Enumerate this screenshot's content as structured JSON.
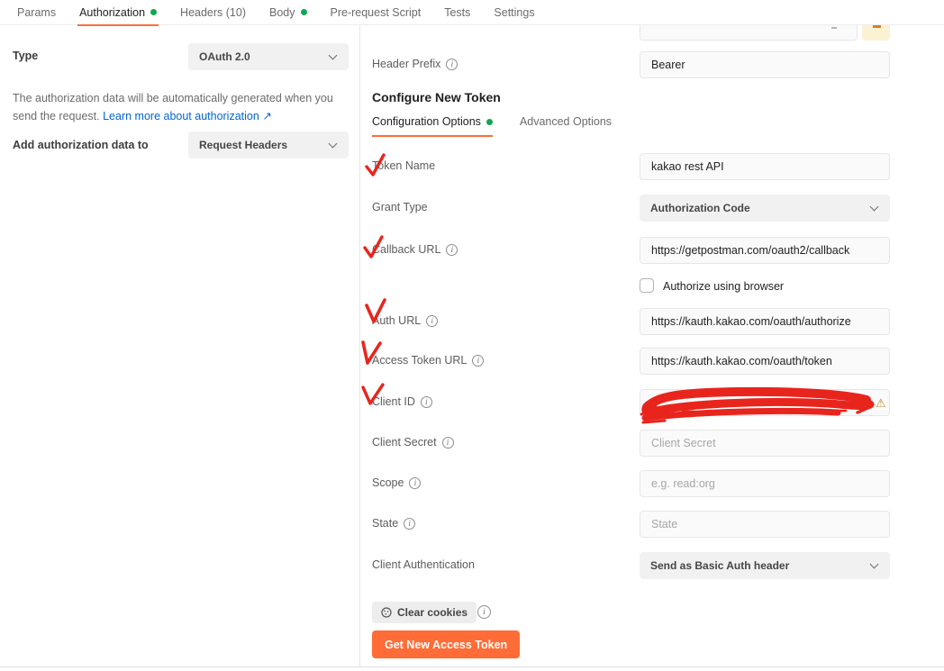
{
  "tab_bar": {
    "tabs": [
      {
        "label": "Params",
        "active": false,
        "has_dot": false
      },
      {
        "label": "Authorization",
        "active": true,
        "has_dot": true
      },
      {
        "label": "Headers (10)",
        "active": false,
        "has_dot": false
      },
      {
        "label": "Body",
        "active": false,
        "has_dot": true
      },
      {
        "label": "Pre-request Script",
        "active": false,
        "has_dot": false
      },
      {
        "label": "Tests",
        "active": false,
        "has_dot": false
      },
      {
        "label": "Settings",
        "active": false,
        "has_dot": false
      }
    ]
  },
  "left_panel": {
    "type_label": "Type",
    "type_value": "OAuth 2.0",
    "description": "The authorization data will be automatically generated when you send the request.",
    "learn_more_link": "Learn more about authorization",
    "external_link_arrow": "↗",
    "add_auth_label": "Add authorization data to",
    "add_auth_value": "Request Headers"
  },
  "right_panel": {
    "header_prefix": {
      "label": "Header Prefix",
      "value": "Bearer"
    },
    "configure_heading": "Configure New Token",
    "config_tabs": [
      {
        "label": "Configuration Options",
        "active": true,
        "has_dot": true
      },
      {
        "label": "Advanced Options",
        "active": false,
        "has_dot": false
      }
    ],
    "fields": {
      "token_name": {
        "label": "Token Name",
        "value": "kakao rest API"
      },
      "grant_type": {
        "label": "Grant Type",
        "value": "Authorization Code"
      },
      "callback_url": {
        "label": "Callback URL",
        "value": "https://getpostman.com/oauth2/callback"
      },
      "authorize_browser": {
        "label": "Authorize using browser",
        "checked": false
      },
      "auth_url": {
        "label": "Auth URL",
        "value": "https://kauth.kakao.com/oauth/authorize"
      },
      "access_token_url": {
        "label": "Access Token URL",
        "value": "https://kauth.kakao.com/oauth/token"
      },
      "client_id": {
        "label": "Client ID",
        "value": "",
        "redacted": true,
        "warning_icon": "⚠"
      },
      "client_secret": {
        "label": "Client Secret",
        "placeholder": "Client Secret"
      },
      "scope": {
        "label": "Scope",
        "placeholder": "e.g. read:org"
      },
      "state": {
        "label": "State",
        "placeholder": "State"
      },
      "client_authentication": {
        "label": "Client Authentication",
        "value": "Send as Basic Auth header"
      }
    },
    "clear_cookies_label": "Clear cookies",
    "get_token_button_label": "Get New Access Token"
  },
  "annotations": {
    "checkmarked_fields": [
      "Token Name",
      "Callback URL",
      "Auth URL",
      "Access Token URL",
      "Client ID"
    ],
    "client_id_redaction": "hand-drawn red scribble over value",
    "annotation_color": "#e8251d"
  },
  "colors": {
    "accent_orange": "#ff6c37",
    "green_dot": "#0da750",
    "link_blue": "#0265d2",
    "warning_amber": "#b98a2f",
    "annotation_red": "#e8251d"
  }
}
